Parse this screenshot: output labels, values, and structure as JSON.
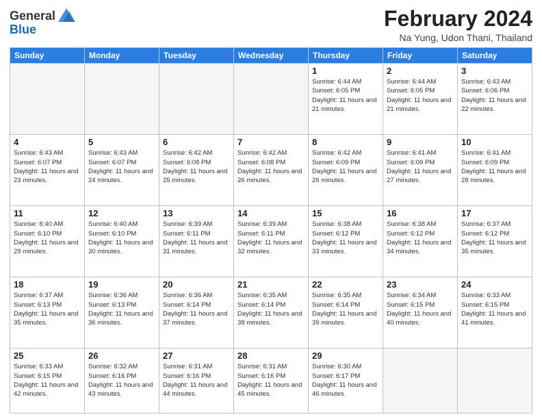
{
  "header": {
    "logo_general": "General",
    "logo_blue": "Blue",
    "title": "February 2024",
    "subtitle": "Na Yung, Udon Thani, Thailand"
  },
  "days_of_week": [
    "Sunday",
    "Monday",
    "Tuesday",
    "Wednesday",
    "Thursday",
    "Friday",
    "Saturday"
  ],
  "weeks": [
    [
      {
        "day": "",
        "info": ""
      },
      {
        "day": "",
        "info": ""
      },
      {
        "day": "",
        "info": ""
      },
      {
        "day": "",
        "info": ""
      },
      {
        "day": "1",
        "info": "Sunrise: 6:44 AM\nSunset: 6:05 PM\nDaylight: 11 hours and 21 minutes."
      },
      {
        "day": "2",
        "info": "Sunrise: 6:44 AM\nSunset: 6:05 PM\nDaylight: 11 hours and 21 minutes."
      },
      {
        "day": "3",
        "info": "Sunrise: 6:43 AM\nSunset: 6:06 PM\nDaylight: 11 hours and 22 minutes."
      }
    ],
    [
      {
        "day": "4",
        "info": "Sunrise: 6:43 AM\nSunset: 6:07 PM\nDaylight: 11 hours and 23 minutes."
      },
      {
        "day": "5",
        "info": "Sunrise: 6:43 AM\nSunset: 6:07 PM\nDaylight: 11 hours and 24 minutes."
      },
      {
        "day": "6",
        "info": "Sunrise: 6:42 AM\nSunset: 6:08 PM\nDaylight: 11 hours and 25 minutes."
      },
      {
        "day": "7",
        "info": "Sunrise: 6:42 AM\nSunset: 6:08 PM\nDaylight: 11 hours and 26 minutes."
      },
      {
        "day": "8",
        "info": "Sunrise: 6:42 AM\nSunset: 6:09 PM\nDaylight: 11 hours and 26 minutes."
      },
      {
        "day": "9",
        "info": "Sunrise: 6:41 AM\nSunset: 6:09 PM\nDaylight: 11 hours and 27 minutes."
      },
      {
        "day": "10",
        "info": "Sunrise: 6:41 AM\nSunset: 6:09 PM\nDaylight: 11 hours and 28 minutes."
      }
    ],
    [
      {
        "day": "11",
        "info": "Sunrise: 6:40 AM\nSunset: 6:10 PM\nDaylight: 11 hours and 29 minutes."
      },
      {
        "day": "12",
        "info": "Sunrise: 6:40 AM\nSunset: 6:10 PM\nDaylight: 11 hours and 30 minutes."
      },
      {
        "day": "13",
        "info": "Sunrise: 6:39 AM\nSunset: 6:11 PM\nDaylight: 11 hours and 31 minutes."
      },
      {
        "day": "14",
        "info": "Sunrise: 6:39 AM\nSunset: 6:11 PM\nDaylight: 11 hours and 32 minutes."
      },
      {
        "day": "15",
        "info": "Sunrise: 6:38 AM\nSunset: 6:12 PM\nDaylight: 11 hours and 33 minutes."
      },
      {
        "day": "16",
        "info": "Sunrise: 6:38 AM\nSunset: 6:12 PM\nDaylight: 11 hours and 34 minutes."
      },
      {
        "day": "17",
        "info": "Sunrise: 6:37 AM\nSunset: 6:12 PM\nDaylight: 11 hours and 35 minutes."
      }
    ],
    [
      {
        "day": "18",
        "info": "Sunrise: 6:37 AM\nSunset: 6:13 PM\nDaylight: 11 hours and 35 minutes."
      },
      {
        "day": "19",
        "info": "Sunrise: 6:36 AM\nSunset: 6:13 PM\nDaylight: 11 hours and 36 minutes."
      },
      {
        "day": "20",
        "info": "Sunrise: 6:36 AM\nSunset: 6:14 PM\nDaylight: 11 hours and 37 minutes."
      },
      {
        "day": "21",
        "info": "Sunrise: 6:35 AM\nSunset: 6:14 PM\nDaylight: 11 hours and 38 minutes."
      },
      {
        "day": "22",
        "info": "Sunrise: 6:35 AM\nSunset: 6:14 PM\nDaylight: 11 hours and 39 minutes."
      },
      {
        "day": "23",
        "info": "Sunrise: 6:34 AM\nSunset: 6:15 PM\nDaylight: 11 hours and 40 minutes."
      },
      {
        "day": "24",
        "info": "Sunrise: 6:33 AM\nSunset: 6:15 PM\nDaylight: 11 hours and 41 minutes."
      }
    ],
    [
      {
        "day": "25",
        "info": "Sunrise: 6:33 AM\nSunset: 6:15 PM\nDaylight: 11 hours and 42 minutes."
      },
      {
        "day": "26",
        "info": "Sunrise: 6:32 AM\nSunset: 6:16 PM\nDaylight: 11 hours and 43 minutes."
      },
      {
        "day": "27",
        "info": "Sunrise: 6:31 AM\nSunset: 6:16 PM\nDaylight: 11 hours and 44 minutes."
      },
      {
        "day": "28",
        "info": "Sunrise: 6:31 AM\nSunset: 6:16 PM\nDaylight: 11 hours and 45 minutes."
      },
      {
        "day": "29",
        "info": "Sunrise: 6:30 AM\nSunset: 6:17 PM\nDaylight: 11 hours and 46 minutes."
      },
      {
        "day": "",
        "info": ""
      },
      {
        "day": "",
        "info": ""
      }
    ]
  ]
}
